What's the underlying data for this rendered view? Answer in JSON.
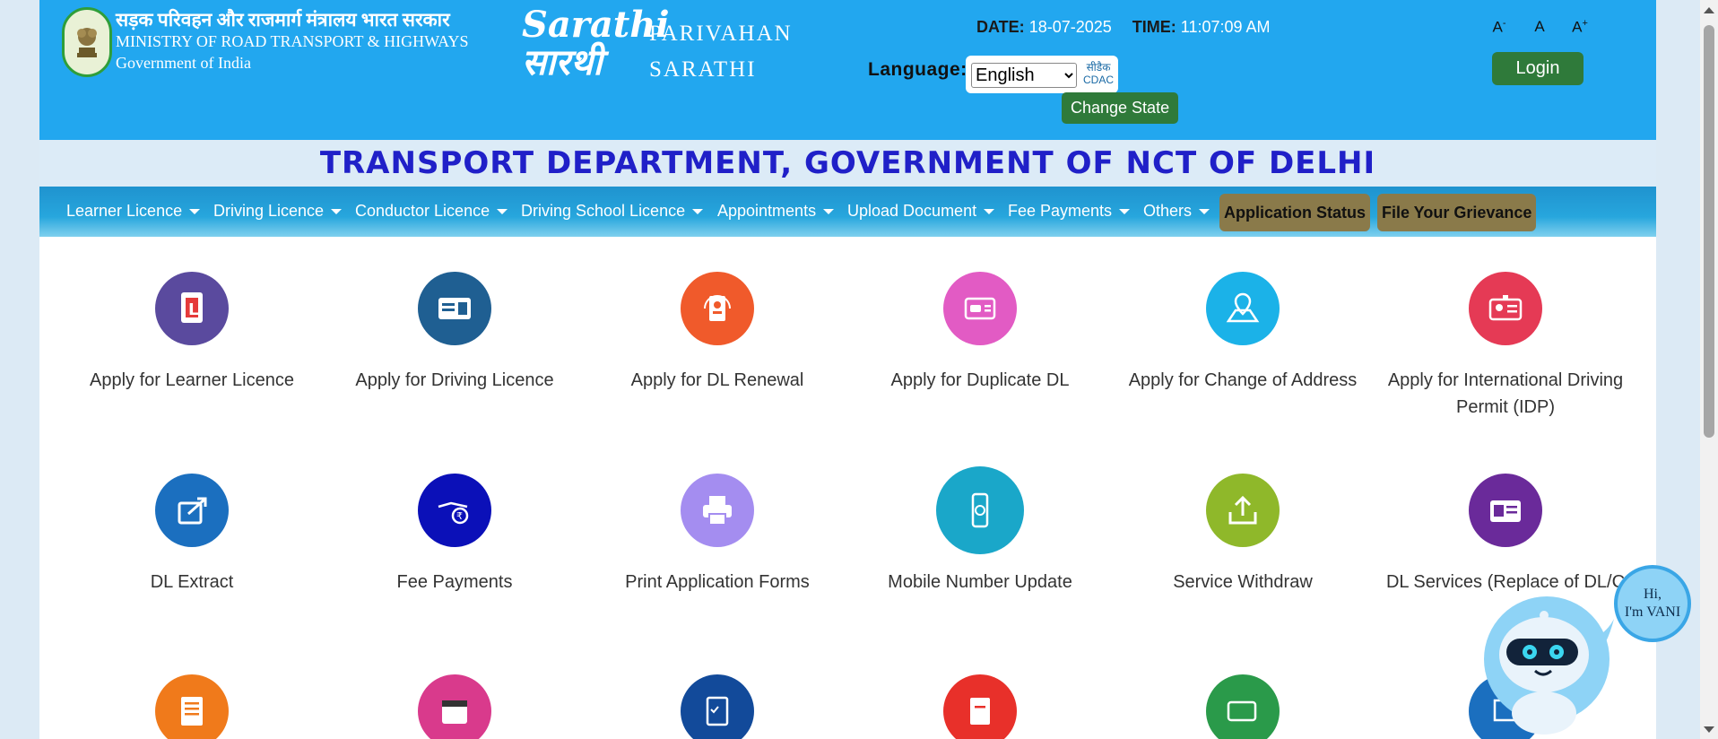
{
  "header": {
    "ministry_hindi": "सड़क परिवहन और राजमार्ग मंत्रालय भारत सरकार",
    "ministry_english": "MINISTRY OF ROAD TRANSPORT & HIGHWAYS",
    "government": "Government of India",
    "logo_script_top": "Sarathi",
    "logo_script_bottom": "सारथी",
    "logo_parivahan": "PARIVAHAN",
    "logo_sarathi": "SARATHI",
    "date_label": "DATE:",
    "date_value": "18-07-2025",
    "time_label": "TIME:",
    "time_value": "11:07:09 AM",
    "language_label": "Language:",
    "language_selected": "English",
    "cdac_hindi": "सीडैक",
    "cdac_english": "CDAC",
    "change_state": "Change State",
    "font_decrease": "A",
    "font_decrease_sup": "-",
    "font_normal": "A",
    "font_increase": "A",
    "font_increase_sup": "+",
    "login": "Login",
    "header_color": "#22a7ef",
    "button_color": "#2f7a3a"
  },
  "department_title": "TRANSPORT DEPARTMENT, GOVERNMENT OF NCT OF DELHI",
  "nav": {
    "items": [
      "Learner Licence",
      "Driving Licence",
      "Conductor Licence",
      "Driving School Licence",
      "Appointments",
      "Upload Document",
      "Fee Payments",
      "Others"
    ],
    "application_status": "Application Status",
    "grievance": "File Your Grievance"
  },
  "services": [
    {
      "label": "Apply for Learner Licence",
      "icon": "learner-licence-icon",
      "color": "#5a4a9e"
    },
    {
      "label": "Apply for Driving Licence",
      "icon": "driving-licence-card-icon",
      "color": "#1f5f92"
    },
    {
      "label": "Apply for DL Renewal",
      "icon": "dl-renewal-icon",
      "color": "#f05a2b"
    },
    {
      "label": "Apply for Duplicate DL",
      "icon": "duplicate-dl-icon",
      "color": "#e25bc4"
    },
    {
      "label": "Apply for Change of Address",
      "icon": "location-pin-icon",
      "color": "#1bb2e8"
    },
    {
      "label": "Apply for International Driving Permit (IDP)",
      "icon": "idp-card-icon",
      "color": "#e53a55"
    },
    {
      "label": "DL Extract",
      "icon": "share-export-icon",
      "color": "#1b6fbf"
    },
    {
      "label": "Fee Payments",
      "icon": "rupee-payment-icon",
      "color": "#0b10b8"
    },
    {
      "label": "Print Application Forms",
      "icon": "printer-icon",
      "color": "#a48df0"
    },
    {
      "label": "Mobile Number Update",
      "icon": "mobile-phone-icon",
      "color": "#1aa7c9"
    },
    {
      "label": "Service Withdraw",
      "icon": "upload-tray-icon",
      "color": "#8fb82a"
    },
    {
      "label": "DL Services (Replace of DL/C",
      "icon": "id-card-icon",
      "color": "#6a2a9a"
    },
    {
      "label": "",
      "icon": "form-list-icon",
      "color": "#f07a1b"
    },
    {
      "label": "",
      "icon": "calendar-icon",
      "color": "#d93a8c"
    },
    {
      "label": "",
      "icon": "clipboard-check-icon",
      "color": "#124a9a"
    },
    {
      "label": "",
      "icon": "clipboard-chart-icon",
      "color": "#e8302a"
    },
    {
      "label": "",
      "icon": "card-check-icon",
      "color": "#2a9a4a"
    },
    {
      "label": "",
      "icon": "edit-icon",
      "color": "#1b6fbf"
    }
  ],
  "chatbot": {
    "greeting_line1": "Hi,",
    "greeting_line2": "I'm VANI"
  }
}
